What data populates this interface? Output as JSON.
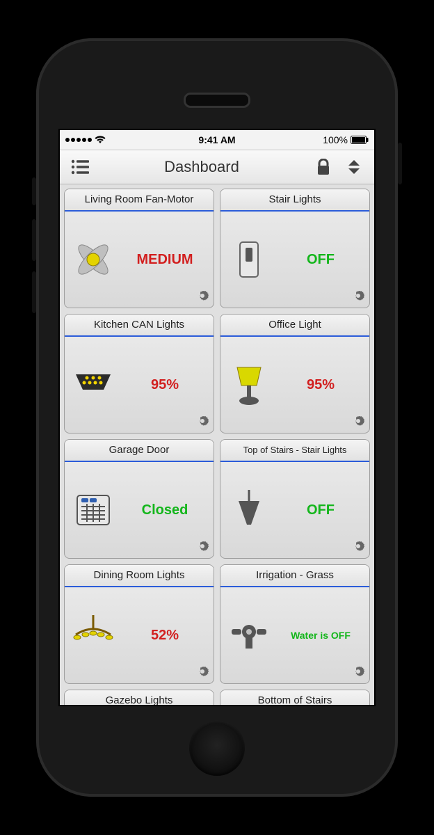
{
  "statusbar": {
    "time": "9:41 AM",
    "battery": "100%"
  },
  "nav": {
    "title": "Dashboard"
  },
  "tiles": [
    {
      "title": "Living Room Fan-Motor",
      "status": "MEDIUM",
      "color": "red",
      "icon": "fan"
    },
    {
      "title": "Stair Lights",
      "status": "OFF",
      "color": "green",
      "icon": "switch"
    },
    {
      "title": "Kitchen CAN Lights",
      "status": "95%",
      "color": "red",
      "icon": "can-lights"
    },
    {
      "title": "Office Light",
      "status": "95%",
      "color": "red",
      "icon": "lamp"
    },
    {
      "title": "Garage Door",
      "status": "Closed",
      "color": "green",
      "icon": "garage"
    },
    {
      "title": "Top of Stairs - Stair Lights",
      "status": "OFF",
      "color": "green",
      "icon": "pendant",
      "smallTitle": true
    },
    {
      "title": "Dining Room Lights",
      "status": "52%",
      "color": "red",
      "icon": "chandelier"
    },
    {
      "title": "Irrigation - Grass",
      "status": "Water is OFF",
      "color": "green",
      "icon": "sprinkler",
      "smallStatus": true
    },
    {
      "title": "Gazebo Lights",
      "short": true
    },
    {
      "title": "Bottom of Stairs",
      "short": true
    }
  ]
}
